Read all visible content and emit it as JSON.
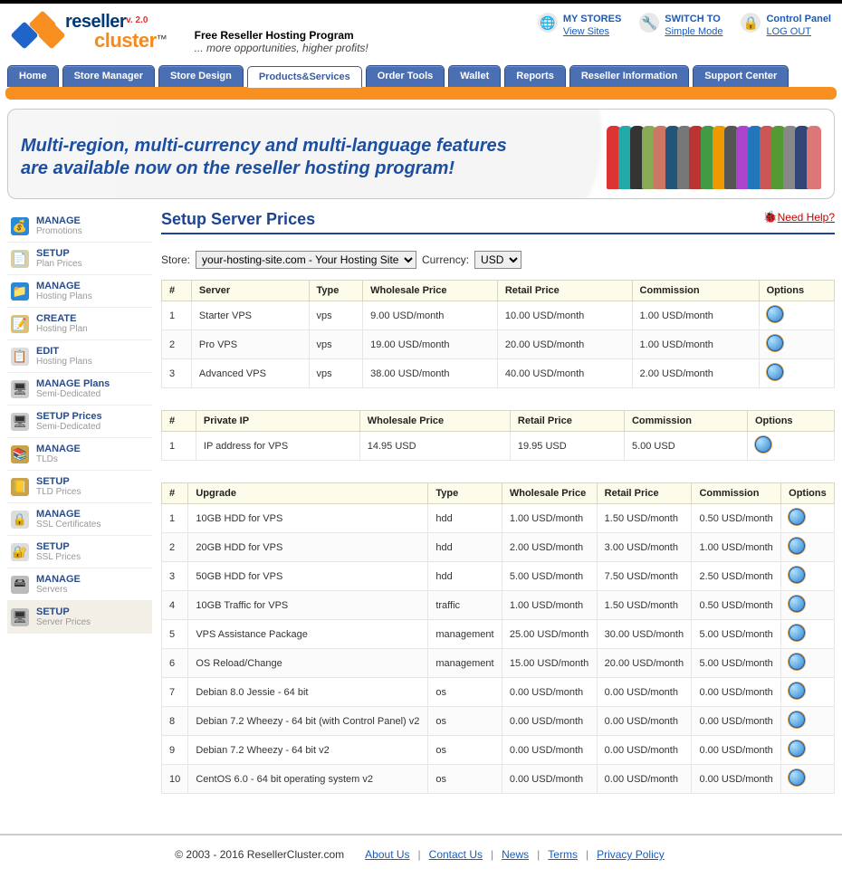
{
  "logo": {
    "line1": "reseller",
    "line2": "cluster",
    "version": "v. 2.0",
    "tm": "™"
  },
  "tagline": {
    "t1": "Free Reseller Hosting Program",
    "t2": "... more opportunities, higher profits!"
  },
  "header_links": [
    {
      "icon": "🌐",
      "l1": "MY STORES",
      "l2": "View Sites"
    },
    {
      "icon": "🔧",
      "l1": "SWITCH TO",
      "l2": "Simple Mode"
    },
    {
      "icon": "🔒",
      "l1": "Control Panel",
      "l2": "LOG OUT"
    }
  ],
  "nav": [
    {
      "label": "Home",
      "active": false
    },
    {
      "label": "Store Manager",
      "active": false
    },
    {
      "label": "Store Design",
      "active": false
    },
    {
      "label": "Products&Services",
      "active": true
    },
    {
      "label": "Order Tools",
      "active": false
    },
    {
      "label": "Wallet",
      "active": false
    },
    {
      "label": "Reports",
      "active": false
    },
    {
      "label": "Reseller Information",
      "active": false
    },
    {
      "label": "Support Center",
      "active": false
    }
  ],
  "banner_text": "Multi-region, multi-currency and multi-language features are available now on the reseller hosting program!",
  "crowd_colors": [
    "#d33",
    "#2aa",
    "#333",
    "#8a5",
    "#c76",
    "#257",
    "#777",
    "#b33",
    "#494",
    "#e90",
    "#555",
    "#a4c",
    "#27b",
    "#c55",
    "#593",
    "#888",
    "#347",
    "#d77"
  ],
  "sidebar": [
    {
      "s1": "MANAGE",
      "s2": "Promotions",
      "ico": "💰",
      "bg": "#2a88d8"
    },
    {
      "s1": "SETUP",
      "s2": "Plan Prices",
      "ico": "📄",
      "bg": "#d9d0a8"
    },
    {
      "s1": "MANAGE",
      "s2": "Hosting Plans",
      "ico": "📁",
      "bg": "#2a88d8"
    },
    {
      "s1": "CREATE",
      "s2": "Hosting Plan",
      "ico": "📝",
      "bg": "#e0c070"
    },
    {
      "s1": "EDIT",
      "s2": "Hosting Plans",
      "ico": "📋",
      "bg": "#ddd"
    },
    {
      "s1": "MANAGE Plans",
      "s2": "Semi-Dedicated",
      "ico": "🖥",
      "bg": "#ccc"
    },
    {
      "s1": "SETUP Prices",
      "s2": "Semi-Dedicated",
      "ico": "🖥",
      "bg": "#ccc"
    },
    {
      "s1": "MANAGE",
      "s2": "TLDs",
      "ico": "📚",
      "bg": "#c9a24a"
    },
    {
      "s1": "SETUP",
      "s2": "TLD Prices",
      "ico": "📒",
      "bg": "#c9a24a"
    },
    {
      "s1": "MANAGE",
      "s2": "SSL Certificates",
      "ico": "🔒",
      "bg": "#ddd"
    },
    {
      "s1": "SETUP",
      "s2": "SSL Prices",
      "ico": "🔐",
      "bg": "#ddd"
    },
    {
      "s1": "MANAGE",
      "s2": "Servers",
      "ico": "🖴",
      "bg": "#bbb"
    },
    {
      "s1": "SETUP",
      "s2": "Server Prices",
      "ico": "🖥",
      "bg": "#bbb",
      "active": true
    }
  ],
  "page_title": "Setup Server Prices",
  "help_label": "Need Help?",
  "filters": {
    "store_label": "Store:",
    "store_value": "your-hosting-site.com - Your Hosting Site",
    "currency_label": "Currency:",
    "currency_value": "USD"
  },
  "table1": {
    "headers": [
      "#",
      "Server",
      "Type",
      "Wholesale Price",
      "Retail Price",
      "Commission",
      "Options"
    ],
    "rows": [
      [
        "1",
        "Starter VPS",
        "vps",
        "9.00 USD/month",
        "10.00 USD/month",
        "1.00 USD/month"
      ],
      [
        "2",
        "Pro VPS",
        "vps",
        "19.00 USD/month",
        "20.00 USD/month",
        "1.00 USD/month"
      ],
      [
        "3",
        "Advanced VPS",
        "vps",
        "38.00 USD/month",
        "40.00 USD/month",
        "2.00 USD/month"
      ]
    ]
  },
  "table2": {
    "headers": [
      "#",
      "Private IP",
      "Wholesale Price",
      "Retail Price",
      "Commission",
      "Options"
    ],
    "rows": [
      [
        "1",
        "IP address for VPS",
        "14.95 USD",
        "19.95 USD",
        "5.00 USD"
      ]
    ]
  },
  "table3": {
    "headers": [
      "#",
      "Upgrade",
      "Type",
      "Wholesale Price",
      "Retail Price",
      "Commission",
      "Options"
    ],
    "rows": [
      [
        "1",
        "10GB HDD for VPS",
        "hdd",
        "1.00 USD/month",
        "1.50 USD/month",
        "0.50 USD/month"
      ],
      [
        "2",
        "20GB HDD for VPS",
        "hdd",
        "2.00 USD/month",
        "3.00 USD/month",
        "1.00 USD/month"
      ],
      [
        "3",
        "50GB HDD for VPS",
        "hdd",
        "5.00 USD/month",
        "7.50 USD/month",
        "2.50 USD/month"
      ],
      [
        "4",
        "10GB Traffic for VPS",
        "traffic",
        "1.00 USD/month",
        "1.50 USD/month",
        "0.50 USD/month"
      ],
      [
        "5",
        "VPS Assistance Package",
        "management",
        "25.00 USD/month",
        "30.00 USD/month",
        "5.00 USD/month"
      ],
      [
        "6",
        "OS Reload/Change",
        "management",
        "15.00 USD/month",
        "20.00 USD/month",
        "5.00 USD/month"
      ],
      [
        "7",
        "Debian 8.0 Jessie - 64 bit",
        "os",
        "0.00 USD/month",
        "0.00 USD/month",
        "0.00 USD/month"
      ],
      [
        "8",
        "Debian 7.2 Wheezy - 64 bit (with Control Panel) v2",
        "os",
        "0.00 USD/month",
        "0.00 USD/month",
        "0.00 USD/month"
      ],
      [
        "9",
        "Debian 7.2 Wheezy - 64 bit v2",
        "os",
        "0.00 USD/month",
        "0.00 USD/month",
        "0.00 USD/month"
      ],
      [
        "10",
        "CentOS 6.0 - 64 bit operating system v2",
        "os",
        "0.00 USD/month",
        "0.00 USD/month",
        "0.00 USD/month"
      ]
    ]
  },
  "footer": {
    "copyright": "© 2003 - 2016 ResellerCluster.com",
    "links": [
      "About Us",
      "Contact Us",
      "News",
      "Terms",
      "Privacy Policy"
    ]
  }
}
